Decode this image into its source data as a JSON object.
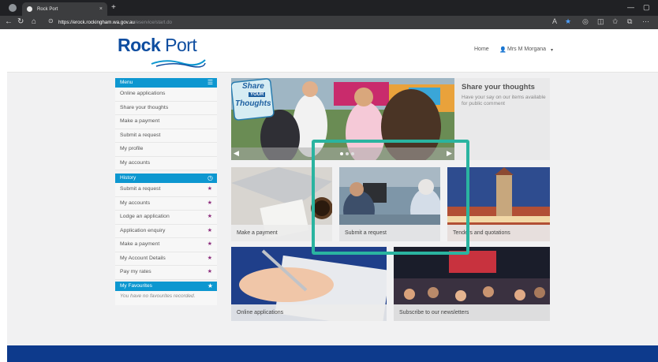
{
  "browser": {
    "tab_title": "Rock Port",
    "tab_close": "×",
    "new_tab": "+",
    "url_host": "https://erock.rockingham.wa.gov.au",
    "url_path": "/eservice/start.do",
    "win_min": "—",
    "win_max": "▢"
  },
  "header": {
    "logo_bold": "Rock",
    "logo_light": "Port",
    "nav_home": "Home",
    "user_name": "Mrs M Morgana",
    "user_caret": "▾"
  },
  "menu": {
    "title": "Menu",
    "items": [
      {
        "label": "Online applications"
      },
      {
        "label": "Share your thoughts"
      },
      {
        "label": "Make a payment"
      },
      {
        "label": "Submit a request"
      },
      {
        "label": "My profile"
      },
      {
        "label": "My accounts"
      }
    ]
  },
  "history": {
    "title": "History",
    "items": [
      {
        "label": "Submit a request"
      },
      {
        "label": "My accounts"
      },
      {
        "label": "Lodge an application"
      },
      {
        "label": "Application enquiry"
      },
      {
        "label": "Make a payment"
      },
      {
        "label": "My Account Details"
      },
      {
        "label": "Pay my rates"
      }
    ]
  },
  "favourites": {
    "title": "My Favourites",
    "empty_text": "You have no favourites recorded."
  },
  "hero": {
    "sign_line1": "Share",
    "sign_line2": "YOUR",
    "sign_line3": "Thoughts",
    "panel_title": "Share your thoughts",
    "panel_text": "Have your say on our items available for public comment"
  },
  "tiles": {
    "payment": "Make a payment",
    "request": "Submit a request",
    "tenders": "Tenders and quotations",
    "online": "Online applications",
    "newsletter": "Subscribe to our newsletters"
  },
  "colors": {
    "brand_blue": "#0e4da0",
    "sidebar_blue": "#0d97d0",
    "highlight": "#2ab4a0",
    "footer": "#0d3a8c"
  }
}
